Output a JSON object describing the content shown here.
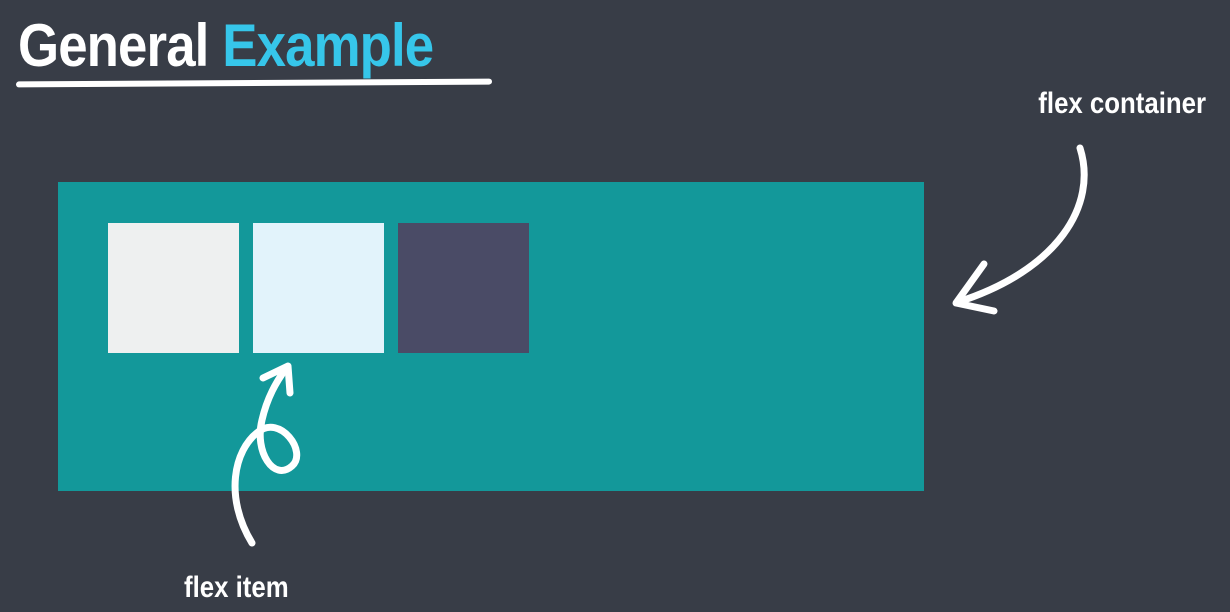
{
  "title": {
    "part1": "General",
    "part2": "Example"
  },
  "labels": {
    "flex_container": "flex container",
    "flex_item": "flex item"
  },
  "colors": {
    "background": "#383d47",
    "title_accent": "#36c6ea",
    "container": "#13989a",
    "item_1": "#eef0f0",
    "item_2": "#e2f3fb",
    "item_3": "#4a4b66",
    "text": "#ffffff"
  }
}
